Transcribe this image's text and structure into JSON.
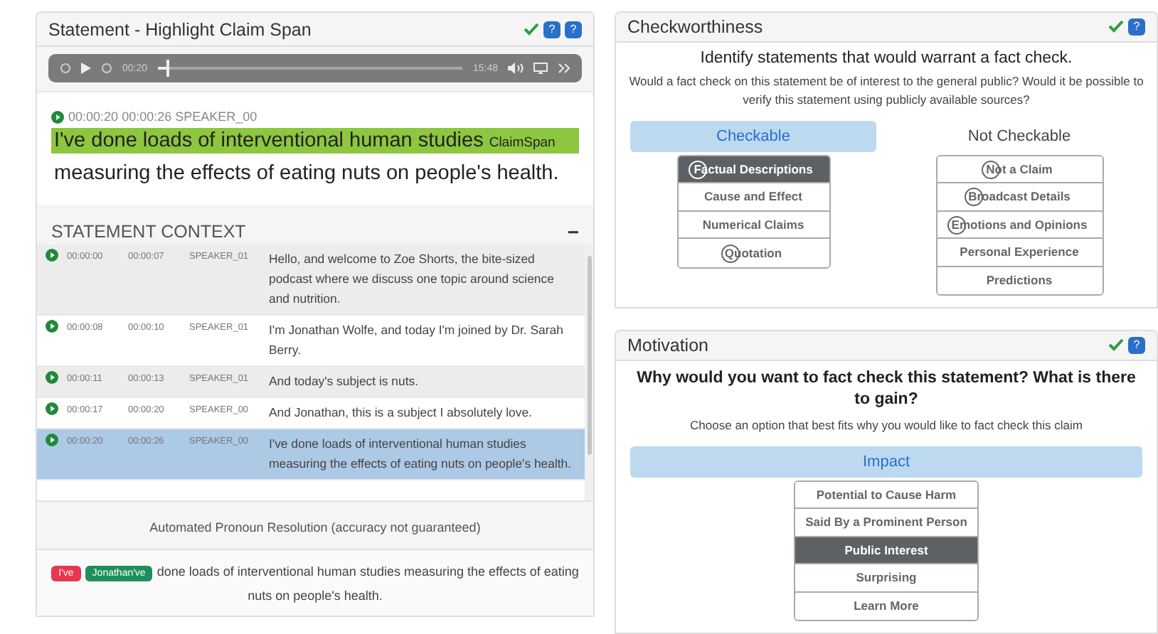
{
  "statement_panel": {
    "title": "Statement - Highlight Claim Span",
    "done": true,
    "help_badges": [
      "?",
      "?"
    ],
    "player": {
      "current": "00:20",
      "duration": "15:48",
      "level": 0.03
    },
    "segment": {
      "start": "00:00:20",
      "end": "00:00:26",
      "speaker": "SPEAKER_00",
      "highlighted": "I've done loads of interventional human studies",
      "tag": "ClaimSpan",
      "rest": "measuring the effects of eating nuts on people's health."
    },
    "context": {
      "title": "STATEMENT CONTEXT",
      "collapse": "−",
      "rows": [
        {
          "start": "00:00:00",
          "end": "00:00:07",
          "speaker": "SPEAKER_01",
          "text": "Hello, and welcome to Zoe Shorts, the bite-sized podcast where we discuss one topic around science and nutrition.",
          "selected": false
        },
        {
          "start": "00:00:08",
          "end": "00:00:10",
          "speaker": "SPEAKER_01",
          "text": "I'm Jonathan Wolfe, and today I'm joined by Dr. Sarah Berry.",
          "selected": false
        },
        {
          "start": "00:00:11",
          "end": "00:00:13",
          "speaker": "SPEAKER_01",
          "text": "And today's subject is nuts.",
          "selected": false
        },
        {
          "start": "00:00:17",
          "end": "00:00:20",
          "speaker": "SPEAKER_00",
          "text": "And Jonathan, this is a subject I absolutely love.",
          "selected": false
        },
        {
          "start": "00:00:20",
          "end": "00:00:26",
          "speaker": "SPEAKER_00",
          "text": "I've done loads of interventional human studies measuring the effects of eating nuts on people's health.",
          "selected": true
        }
      ]
    },
    "pronoun": {
      "title": "Automated Pronoun Resolution (accuracy not guaranteed)",
      "tags": [
        {
          "label": "I've",
          "color": "#e8364f"
        },
        {
          "label": "Jonathan've",
          "color": "#1e8f5a"
        }
      ],
      "text": "done loads of interventional human studies measuring the effects of eating nuts on people's health."
    }
  },
  "checkworthiness": {
    "title": "Checkworthiness",
    "done": true,
    "help_badge": "?",
    "heading": "Identify statements that would warrant a fact check.",
    "question": "Would a fact check on this statement be of interest to the general public? Would it be possible to verify this statement using publicly available sources?",
    "groups": [
      {
        "label": "Checkable",
        "selected": true,
        "options": [
          {
            "label": "Factual Descriptions",
            "shortcut": true,
            "selected": true
          },
          {
            "label": "Cause and Effect",
            "shortcut": false,
            "selected": false
          },
          {
            "label": "Numerical Claims",
            "shortcut": false,
            "selected": false
          },
          {
            "label": "Quotation",
            "shortcut": true,
            "selected": false
          }
        ]
      },
      {
        "label": "Not Checkable",
        "selected": false,
        "options": [
          {
            "label": "Not a Claim",
            "shortcut": true,
            "selected": false
          },
          {
            "label": "Broadcast Details",
            "shortcut": true,
            "selected": false
          },
          {
            "label": "Emotions and Opinions",
            "shortcut": true,
            "selected": false
          },
          {
            "label": "Personal Experience",
            "shortcut": false,
            "selected": false
          },
          {
            "label": "Predictions",
            "shortcut": false,
            "selected": false
          }
        ]
      }
    ]
  },
  "motivation": {
    "title": "Motivation",
    "done": true,
    "help_badge": "?",
    "heading": "Why would you want to fact check this statement? What is there to gain?",
    "hint": "Choose an option that best fits why you would like to fact check this claim",
    "group": {
      "label": "Impact",
      "selected": true
    },
    "options": [
      {
        "label": "Potential to Cause Harm",
        "selected": false
      },
      {
        "label": "Said By a Prominent Person",
        "selected": false
      },
      {
        "label": "Public Interest",
        "selected": true
      },
      {
        "label": "Surprising",
        "selected": false
      },
      {
        "label": "Learn More",
        "selected": false
      }
    ]
  }
}
